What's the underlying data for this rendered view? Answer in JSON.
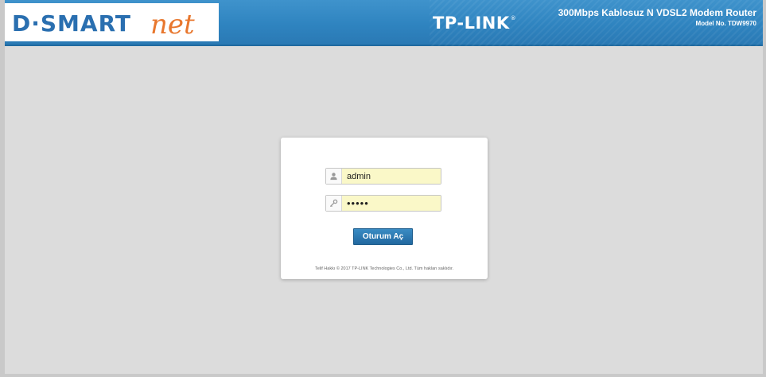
{
  "header": {
    "logo_text": "D·SMARTnet",
    "brand_name": "TP-LINK",
    "brand_mark": "®",
    "product_name": "300Mbps Kablosuz N VDSL2 Modem Router",
    "model_number": "Model No. TDW9970"
  },
  "login": {
    "username": {
      "icon": "user-icon",
      "value": "admin"
    },
    "password": {
      "icon": "key-icon",
      "value": "•••••"
    },
    "submit_label": "Oturum Aç",
    "copyright": "Telif Hakkı © 2017 TP-LINK Technologies Co., Ltd. Tüm hakları saklıdır."
  },
  "colors": {
    "header_blue": "#2f84c0",
    "autofill_yellow": "#faf8c8",
    "button_blue": "#21689f",
    "logo_orange": "#e8772e",
    "logo_blue": "#2a6fb0",
    "page_background": "#dcdcdc"
  }
}
